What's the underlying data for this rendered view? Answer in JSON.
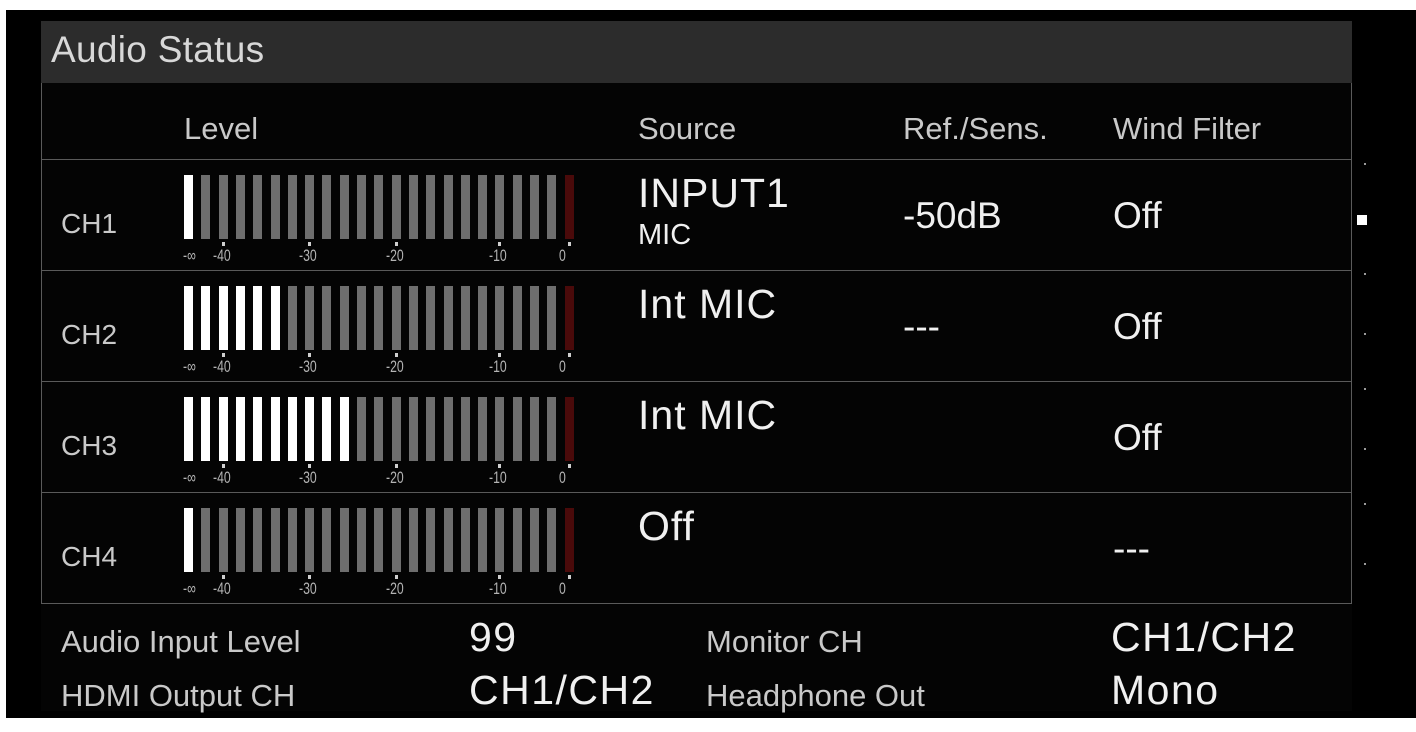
{
  "panel": {
    "title": "Audio Status"
  },
  "headers": {
    "level": "Level",
    "source": "Source",
    "ref_sens": "Ref./Sens.",
    "wind_filter": "Wind Filter"
  },
  "meter_scale": [
    "-∞",
    "-40",
    "-30",
    "-20",
    "-10",
    "0"
  ],
  "channels": [
    {
      "label": "CH1",
      "level_lit_segments": 1,
      "source_main": "INPUT1",
      "source_sub": "MIC",
      "ref_sens": "-50dB",
      "wind_filter": "Off"
    },
    {
      "label": "CH2",
      "level_lit_segments": 6,
      "source_main": "Int MIC",
      "source_sub": "",
      "ref_sens": "---",
      "wind_filter": "Off"
    },
    {
      "label": "CH3",
      "level_lit_segments": 10,
      "source_main": "Int MIC",
      "source_sub": "",
      "ref_sens": "",
      "wind_filter": "Off"
    },
    {
      "label": "CH4",
      "level_lit_segments": 1,
      "source_main": "Off",
      "source_sub": "",
      "ref_sens": "",
      "wind_filter": "---"
    }
  ],
  "meter_total_segments": 23,
  "bottom": {
    "audio_input_level_label": "Audio Input Level",
    "audio_input_level_value": "99",
    "hdmi_output_label": "HDMI Output CH",
    "hdmi_output_value": "CH1/CH2",
    "monitor_ch_label": "Monitor CH",
    "monitor_ch_value": "CH1/CH2",
    "headphone_out_label": "Headphone Out",
    "headphone_out_value": "Mono"
  },
  "colors": {
    "lit": "#ffffff",
    "unlit": "#6e6e6e",
    "peak": "#4a0a0a"
  }
}
